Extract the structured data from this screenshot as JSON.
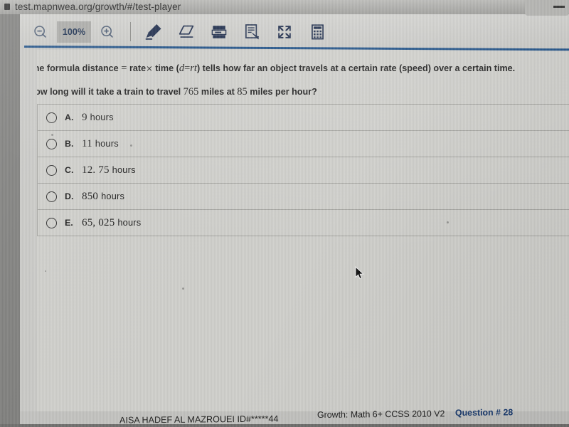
{
  "browser": {
    "url": "test.mapnwea.org/growth/#/test-player",
    "favicon": "tab-favicon-icon"
  },
  "toolbar": {
    "zoom_out_icon": "magnifier-minus-icon",
    "zoom_level": "100%",
    "zoom_in_icon": "magnifier-plus-icon",
    "tools": [
      {
        "name": "highlighter-icon",
        "label": "Highlighter"
      },
      {
        "name": "eraser-icon",
        "label": "Eraser"
      },
      {
        "name": "line-reader-icon",
        "label": "Line Reader"
      },
      {
        "name": "notepad-icon",
        "label": "Notepad"
      },
      {
        "name": "cross-out-icon",
        "label": "Cross Out Answers"
      },
      {
        "name": "calculator-icon",
        "label": "Calculator"
      }
    ]
  },
  "question": {
    "stem_line1_a": "The formula distance",
    "stem_line1_eq": "=",
    "stem_line1_b": "rate",
    "stem_line1_times": "×",
    "stem_line1_c": "time (",
    "stem_line1_d": "d",
    "stem_line1_eq2": "=",
    "stem_line1_rt": "rt",
    "stem_line1_e": ") tells how far an object travels at a certain rate (speed) over a certain time.",
    "stem_line2_a": "How long will it take a train to travel",
    "stem_line2_n1": "765",
    "stem_line2_b": "miles at",
    "stem_line2_n2": "85",
    "stem_line2_c": "miles per hour?",
    "options": [
      {
        "letter": "A.",
        "value": "9",
        "unit": "hours"
      },
      {
        "letter": "B.",
        "value": "11",
        "unit": "hours"
      },
      {
        "letter": "C.",
        "value": "12. 75",
        "unit": "hours"
      },
      {
        "letter": "D.",
        "value": "850",
        "unit": "hours"
      },
      {
        "letter": "E.",
        "value": "65, 025",
        "unit": "hours"
      }
    ]
  },
  "footer": {
    "student": "AISA HADEF AL MAZROUEI  ID#*****44",
    "test_name": "Growth: Math 6+ CCSS 2010 V2",
    "question_number": "Question # 28",
    "next_button": "next-arrow-icon"
  },
  "colors": {
    "accent_blue": "#1d4f86",
    "question_blue": "#17386d",
    "icon_navy": "#1b2a4a",
    "panel": "#cfcfcb"
  }
}
